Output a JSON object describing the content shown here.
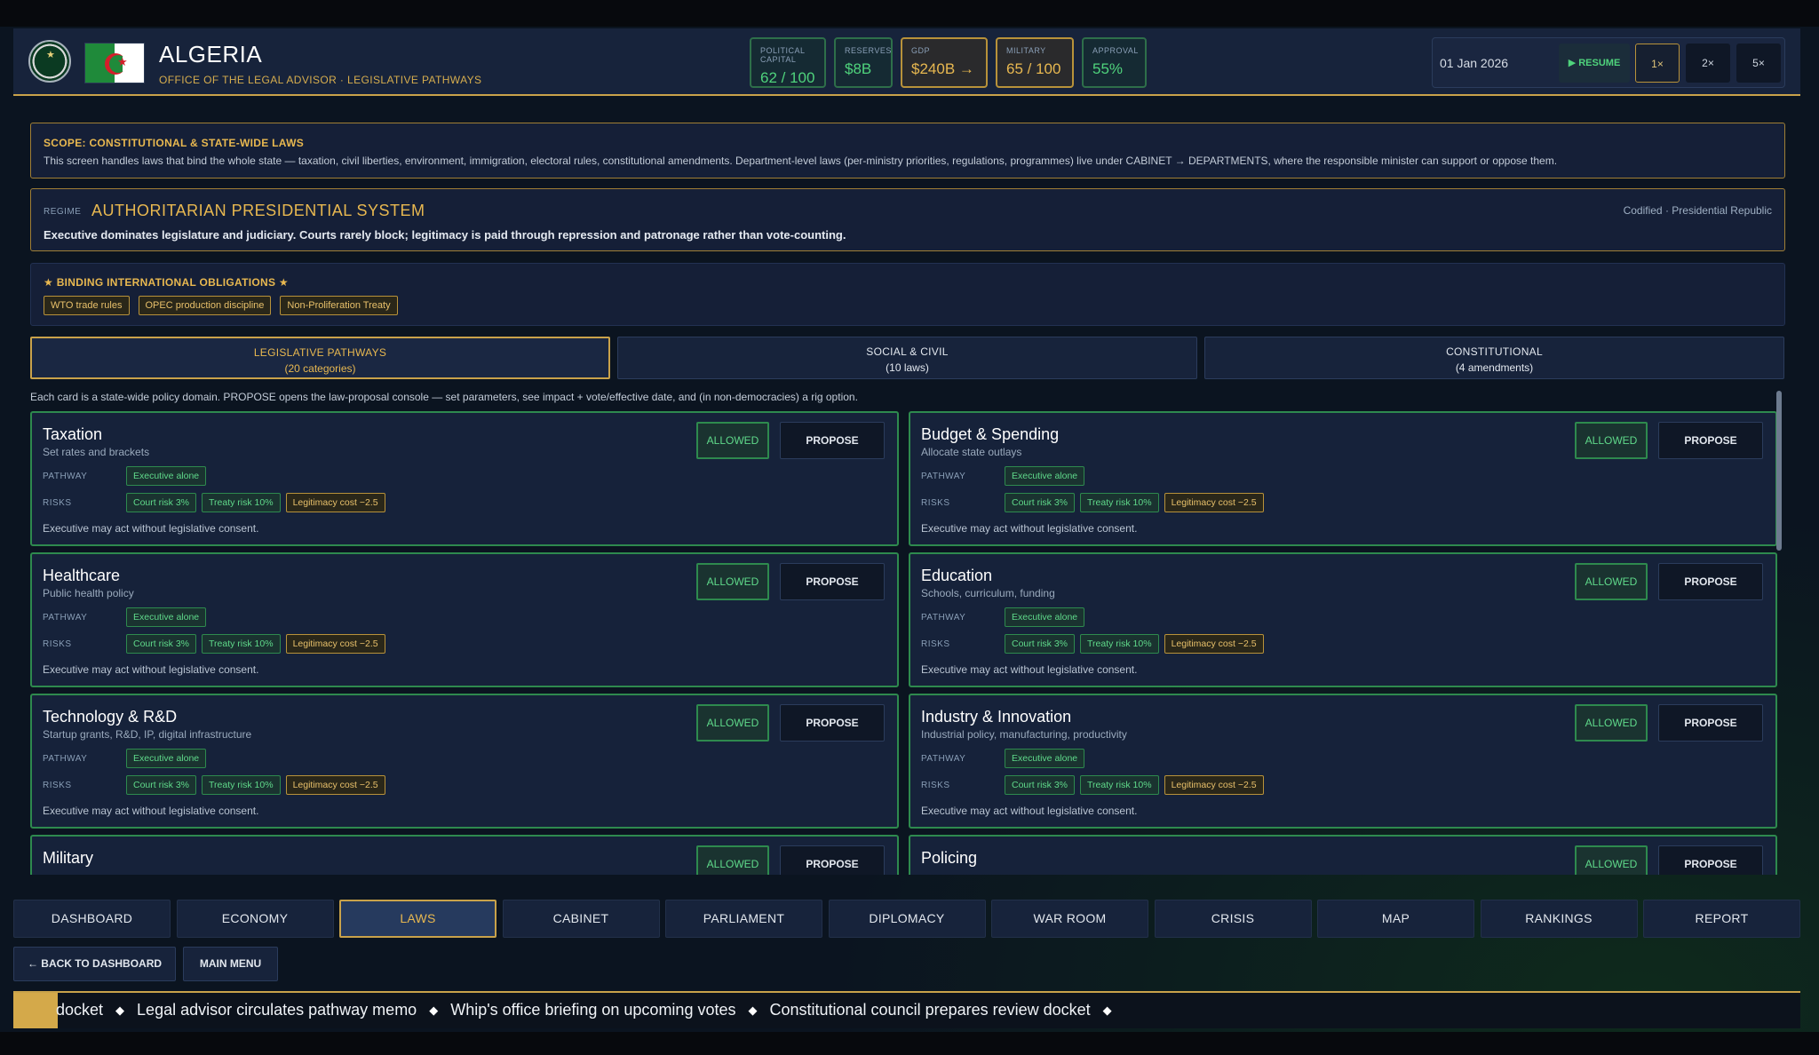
{
  "header": {
    "country": "ALGERIA",
    "subtitle": "OFFICE OF THE LEGAL ADVISOR · LEGISLATIVE PATHWAYS",
    "stats": [
      {
        "label": "POLITICAL CAPITAL",
        "value": "62 / 100"
      },
      {
        "label": "RESERVES",
        "value": "$8B"
      },
      {
        "label": "GDP",
        "value": "$240B →"
      },
      {
        "label": "MILITARY",
        "value": "65 / 100"
      },
      {
        "label": "APPROVAL",
        "value": "55%"
      }
    ],
    "date": "01 Jan 2026",
    "resume_label": "▶ RESUME",
    "speeds": [
      "1×",
      "2×",
      "5×"
    ],
    "active_speed": "1×"
  },
  "scope": {
    "title": "SCOPE: CONSTITUTIONAL & STATE-WIDE LAWS",
    "description": "This screen handles laws that bind the whole state — taxation, civil liberties, environment, immigration, electoral rules, constitutional amendments. Department-level laws (per-ministry priorities, regulations, programmes) live under CABINET → DEPARTMENTS, where the responsible minister can support or oppose them."
  },
  "regime": {
    "label": "REGIME",
    "name": "AUTHORITARIAN PRESIDENTIAL SYSTEM",
    "right": "Codified · Presidential Republic",
    "description": "Executive dominates legislature and judiciary. Courts rarely block; legitimacy is paid through repression and patronage rather than vote-counting."
  },
  "obligations": {
    "title": "★  BINDING INTERNATIONAL OBLIGATIONS  ★",
    "items": [
      "WTO trade rules",
      "OPEC production discipline",
      "Non-Proliferation Treaty"
    ]
  },
  "tabs": [
    {
      "label": "LEGISLATIVE PATHWAYS",
      "sub": "(20 categories)",
      "active": true
    },
    {
      "label": "SOCIAL & CIVIL",
      "sub": "(10 laws)",
      "active": false
    },
    {
      "label": "CONSTITUTIONAL",
      "sub": "(4 amendments)",
      "active": false
    }
  ],
  "tab_help": "Each card is a state-wide policy domain. PROPOSE opens the law-proposal console — set parameters, see impact + vote/effective date, and (in non-democracies) a rig option.",
  "card_labels": {
    "pathway": "PATHWAY",
    "risks": "RISKS",
    "allowed": "ALLOWED",
    "propose": "PROPOSE"
  },
  "cards": [
    {
      "title": "Taxation",
      "subtitle": "Set rates and brackets",
      "pathway": "Executive alone",
      "risks": [
        "Court risk 3%",
        "Treaty risk 10%",
        "Legitimacy cost −2.5"
      ],
      "note": "Executive may act without legislative consent."
    },
    {
      "title": "Budget & Spending",
      "subtitle": "Allocate state outlays",
      "pathway": "Executive alone",
      "risks": [
        "Court risk 3%",
        "Treaty risk 10%",
        "Legitimacy cost −2.5"
      ],
      "note": "Executive may act without legislative consent."
    },
    {
      "title": "Healthcare",
      "subtitle": "Public health policy",
      "pathway": "Executive alone",
      "risks": [
        "Court risk 3%",
        "Treaty risk 10%",
        "Legitimacy cost −2.5"
      ],
      "note": "Executive may act without legislative consent."
    },
    {
      "title": "Education",
      "subtitle": "Schools, curriculum, funding",
      "pathway": "Executive alone",
      "risks": [
        "Court risk 3%",
        "Treaty risk 10%",
        "Legitimacy cost −2.5"
      ],
      "note": "Executive may act without legislative consent."
    },
    {
      "title": "Technology & R&D",
      "subtitle": "Startup grants, R&D, IP, digital infrastructure",
      "pathway": "Executive alone",
      "risks": [
        "Court risk 3%",
        "Treaty risk 10%",
        "Legitimacy cost −2.5"
      ],
      "note": "Executive may act without legislative consent."
    },
    {
      "title": "Industry & Innovation",
      "subtitle": "Industrial policy, manufacturing, productivity",
      "pathway": "Executive alone",
      "risks": [
        "Court risk 3%",
        "Treaty risk 10%",
        "Legitimacy cost −2.5"
      ],
      "note": "Executive may act without legislative consent."
    },
    {
      "title": "Military",
      "subtitle": "",
      "pathway": "",
      "risks": [],
      "note": ""
    },
    {
      "title": "Policing",
      "subtitle": "",
      "pathway": "",
      "risks": [],
      "note": ""
    }
  ],
  "nav": [
    "DASHBOARD",
    "ECONOMY",
    "LAWS",
    "CABINET",
    "PARLIAMENT",
    "DIPLOMACY",
    "WAR ROOM",
    "CRISIS",
    "MAP",
    "RANKINGS",
    "REPORT"
  ],
  "nav_active": "LAWS",
  "sub_nav": {
    "back": "← BACK TO DASHBOARD",
    "main_menu": "MAIN MENU"
  },
  "ticker": [
    "docket",
    "Legal advisor circulates pathway memo",
    "Whip's office briefing on upcoming votes",
    "Constitutional council prepares review docket"
  ],
  "colors": {
    "accent_gold": "#c9a24a",
    "allowed_green": "#5fd98a",
    "panel": "#17233b"
  }
}
